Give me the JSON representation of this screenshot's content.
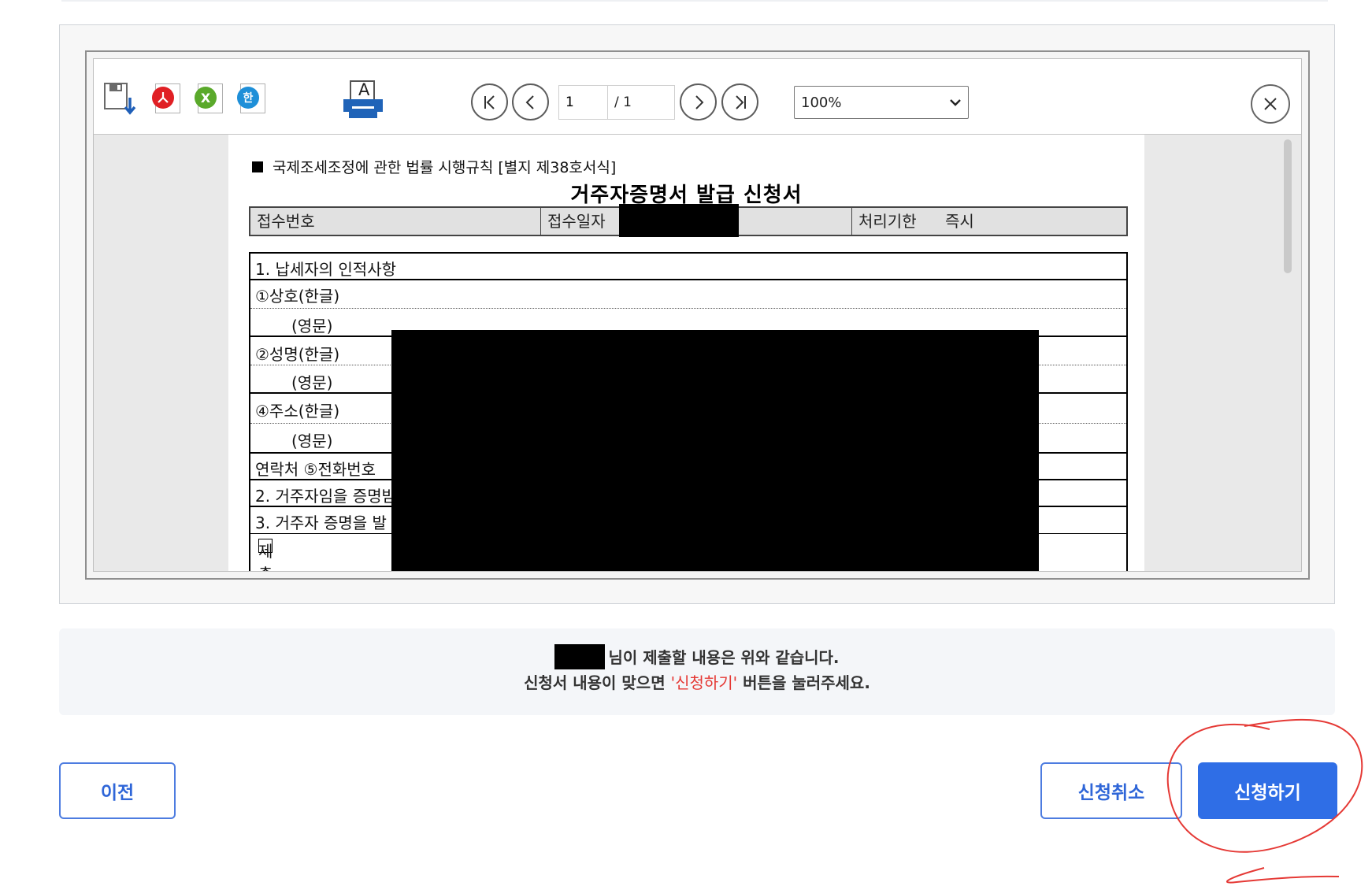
{
  "viewer": {
    "toolbar": {
      "icons": [
        "save-icon",
        "pdf-icon",
        "excel-icon",
        "hwp-icon",
        "print-icon"
      ],
      "excel_glyph": "X",
      "hwp_glyph": "한",
      "print_glyph": "A",
      "page_current": "1",
      "page_total": "/ 1",
      "zoom": "100%"
    },
    "document": {
      "header": "국제조세조정에 관한 법률 시행규칙 [별지 제38호서식]",
      "title": "거주자증명서 발급 신청서",
      "receipt": {
        "no_label": "접수번호",
        "date_label": "접수일자",
        "deadline_label": "처리기한",
        "deadline_value": "즉시"
      },
      "rows": [
        "1.  납세자의 인적사항",
        "①상호(한글)",
        "(영문)",
        "②성명(한글)",
        "(영문)",
        "④주소(한글)",
        "(영문)",
        "연락처    ⑤전화번호",
        "2.  거주자임을 증명받",
        "3.  거주자 증명을 발",
        "제출내용 적용"
      ]
    }
  },
  "notice": {
    "line1_suffix": "님이 제출할 내용은 위와 같습니다.",
    "line2_prefix": "신청서 내용이 맞으면 ",
    "line2_highlight": "'신청하기'",
    "line2_suffix": " 버튼을 눌러주세요."
  },
  "buttons": {
    "prev": "이전",
    "cancel": "신청취소",
    "submit": "신청하기"
  },
  "colors": {
    "primary": "#2f6ee6",
    "highlight": "#e53935",
    "annotation": "#e53935"
  }
}
